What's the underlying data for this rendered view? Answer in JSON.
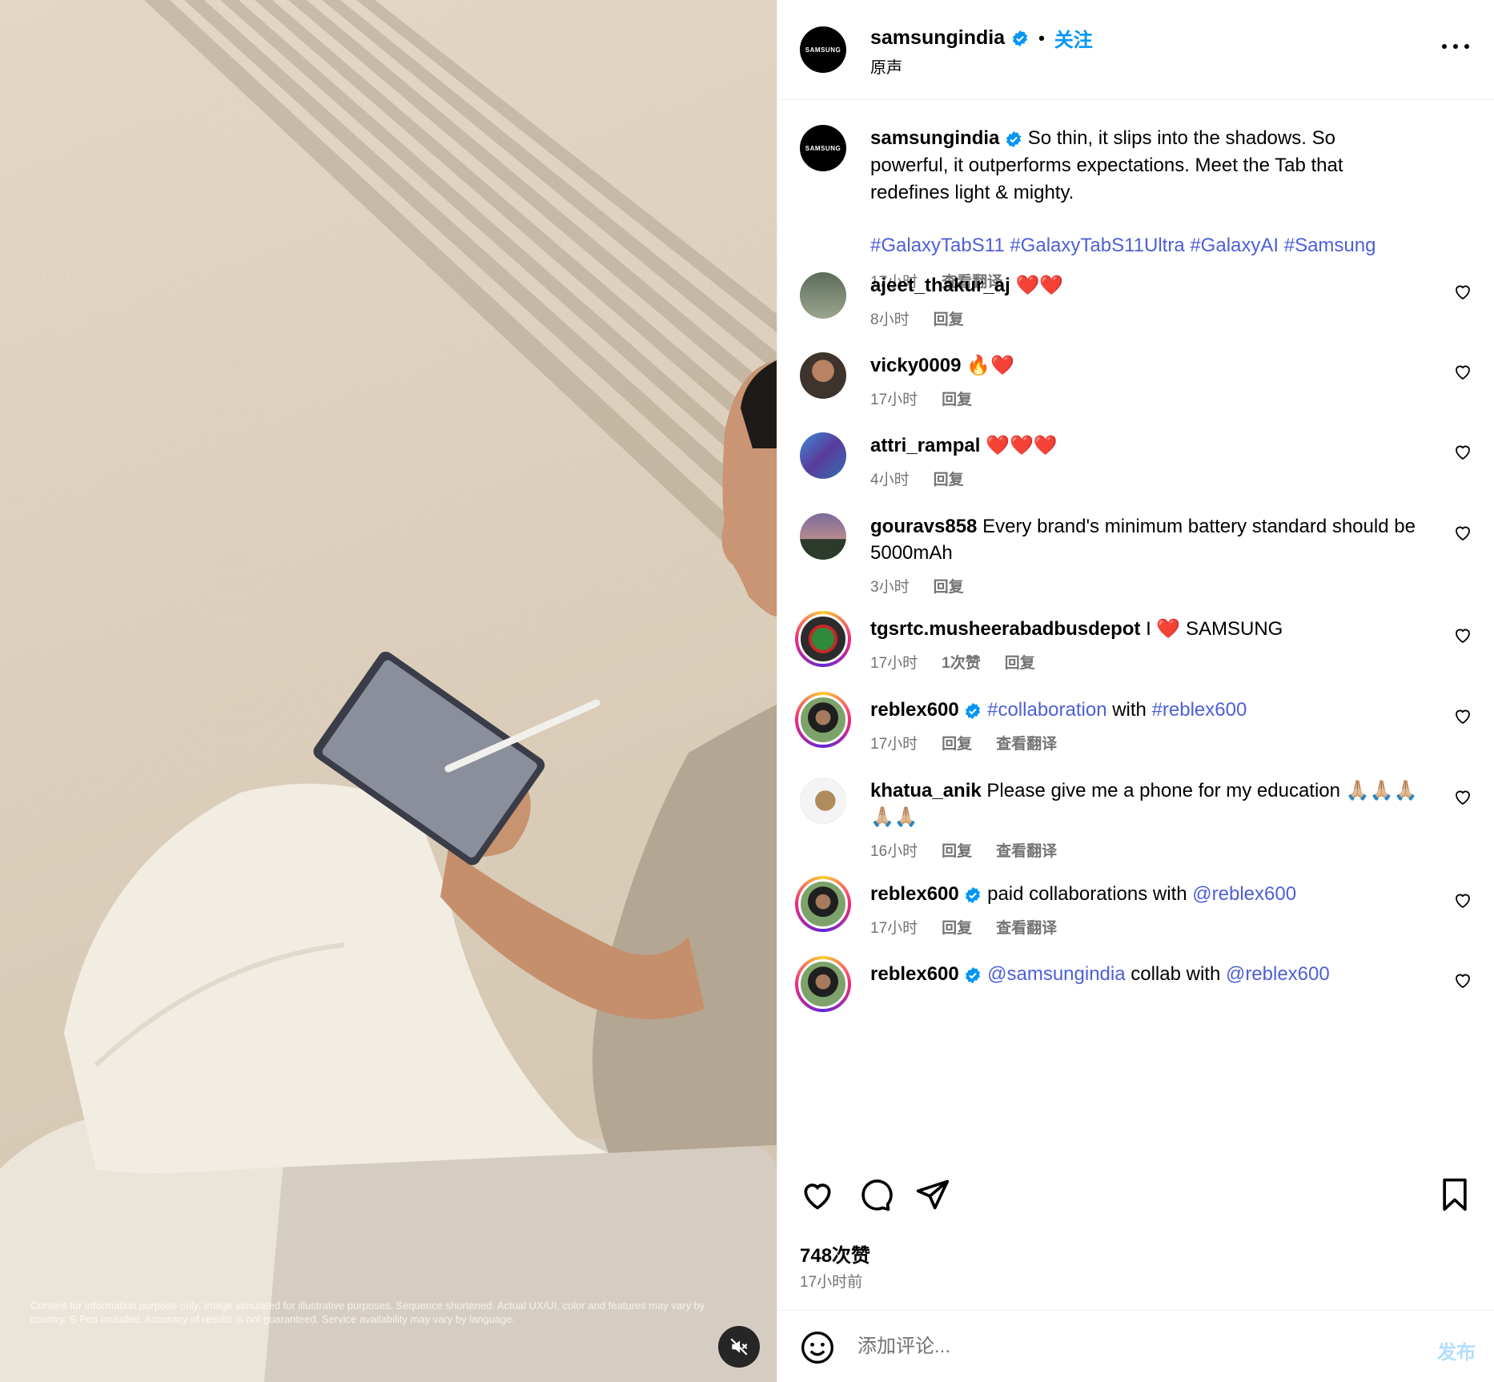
{
  "media": {
    "disclaimer": "Content for information purpose only. Image simulated for illustrative purposes. Sequence shortened. Actual UX/UI, color and features may vary by country. S Pen included. Accuracy of results is not guaranteed. Service availability may vary by language."
  },
  "header": {
    "username": "samsungindia",
    "follow_label": "关注",
    "separator": "•",
    "audio_label": "原声",
    "avatar_text": "SAMSUNG"
  },
  "caption": {
    "username": "samsungindia",
    "text": "So thin, it slips into the shadows. So powerful, it outperforms expectations. Meet the Tab that redefines light & mighty.",
    "hashtags": "#GalaxyTabS11 #GalaxyTabS11Ultra #GalaxyAI #Samsung",
    "time": "17小时",
    "translate": "查看翻译"
  },
  "comments": [
    {
      "username": "ajeet_thakur_aj",
      "text": "❤️❤️",
      "time": "8小时",
      "reply": "回复"
    },
    {
      "username": "vicky0009",
      "text": "🔥❤️",
      "time": "17小时",
      "reply": "回复"
    },
    {
      "username": "attri_rampal",
      "text": "❤️❤️❤️",
      "time": "4小时",
      "reply": "回复"
    },
    {
      "username": "gouravs858",
      "text": "Every brand's minimum battery standard should be 5000mAh",
      "time": "3小时",
      "reply": "回复"
    },
    {
      "username": "tgsrtc.musheerabadbusdepot",
      "text": "I ❤️ SAMSUNG",
      "time": "17小时",
      "likes": "1次赞",
      "reply": "回复"
    },
    {
      "username": "reblex600",
      "tag1": "#collaboration",
      "mid": " with ",
      "tag2": "#reblex600",
      "time": "17小时",
      "reply": "回复",
      "translate": "查看翻译"
    },
    {
      "username": "khatua_anik",
      "text": "Please give me a phone for my education 🙏🏼🙏🏼🙏🏼🙏🏼🙏🏼",
      "time": "16小时",
      "reply": "回复",
      "translate": "查看翻译"
    },
    {
      "username": "reblex600",
      "pre": "paid collaborations with ",
      "tag1": "@reblex600",
      "time": "17小时",
      "reply": "回复",
      "translate": "查看翻译"
    },
    {
      "username": "reblex600",
      "tag1": "@samsungindia",
      "mid": " collab with ",
      "tag2": "@reblex600"
    }
  ],
  "footer": {
    "likes": "748次赞",
    "posted": "17小时前",
    "comment_placeholder": "添加评论...",
    "post_label": "发布"
  },
  "colors": {
    "link": "#0095f6",
    "hashtag": "#4e5fd6",
    "muted": "#737373",
    "verified": "#0095f6"
  },
  "icons": [
    "verified-badge-icon",
    "more-icon",
    "heart-icon",
    "comment-icon",
    "share-icon",
    "bookmark-icon",
    "emoji-icon",
    "mute-icon"
  ]
}
